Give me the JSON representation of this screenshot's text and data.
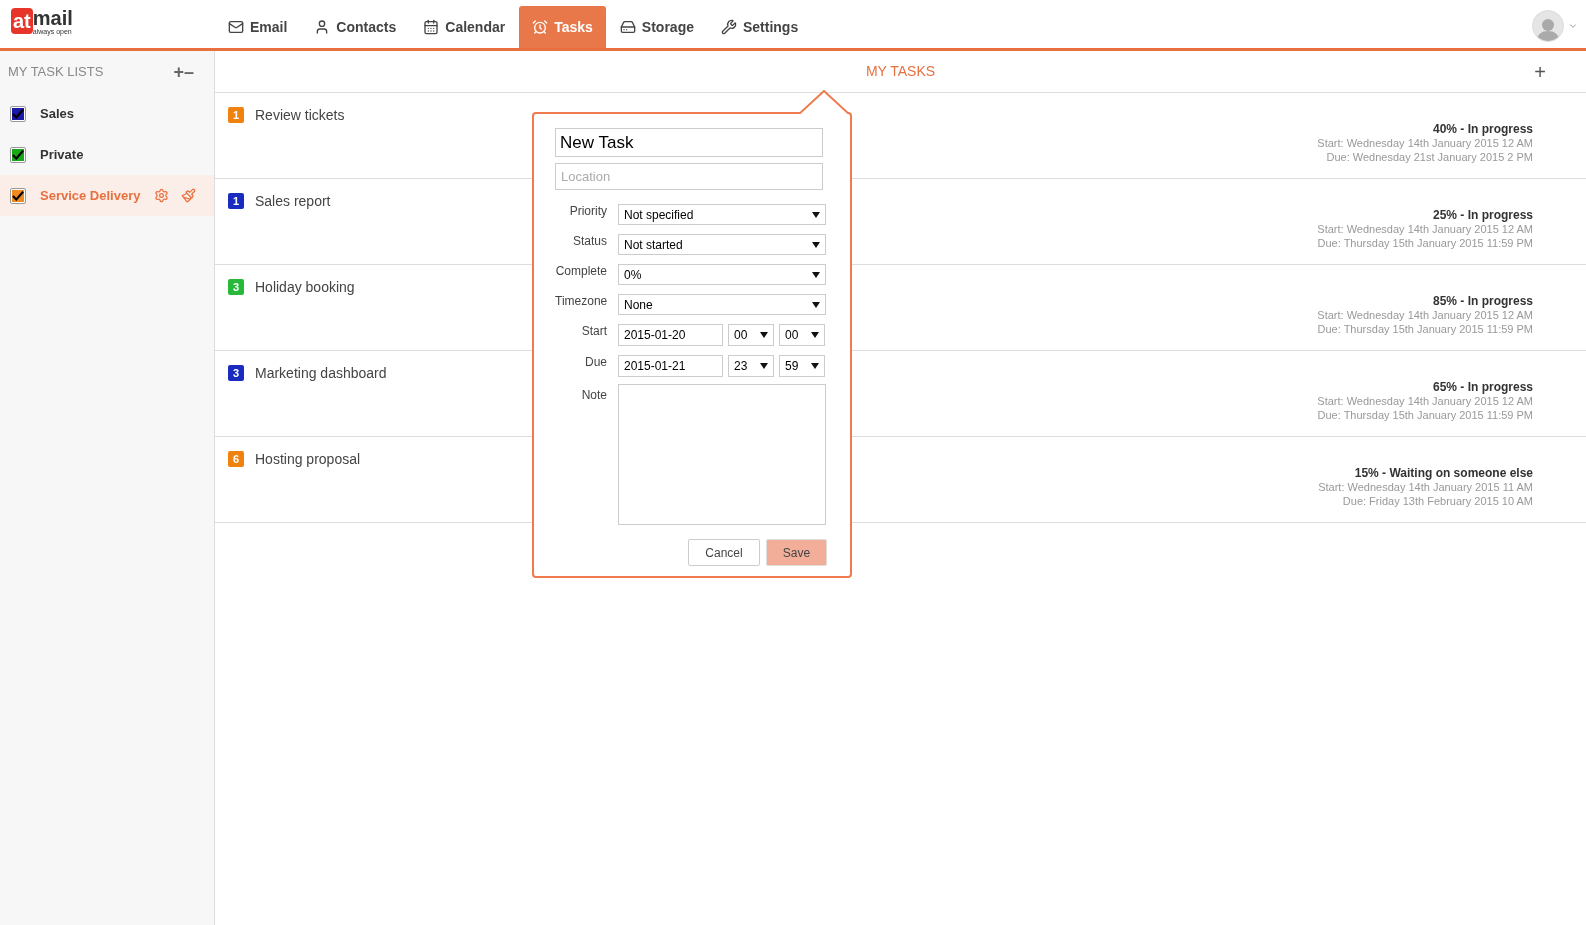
{
  "logo": {
    "mark": "at",
    "word": "mail",
    "tagline": "always open"
  },
  "nav": [
    {
      "label": "Email",
      "kind": "mail",
      "selected": false
    },
    {
      "label": "Contacts",
      "kind": "user",
      "selected": false
    },
    {
      "label": "Calendar",
      "kind": "calendar",
      "selected": false
    },
    {
      "label": "Tasks",
      "kind": "alarm",
      "selected": true
    },
    {
      "label": "Storage",
      "kind": "storage",
      "selected": false
    },
    {
      "label": "Settings",
      "kind": "tools",
      "selected": false
    }
  ],
  "sidebar": {
    "title": "MY TASK LISTS",
    "add": "+",
    "remove": "–",
    "items": [
      {
        "label": "Sales",
        "color": "#1a1aa8",
        "checked": true,
        "selected": false
      },
      {
        "label": "Private",
        "color": "#1aa81a",
        "checked": true,
        "selected": false
      },
      {
        "label": "Service Delivery",
        "color": "#f08a1c",
        "checked": true,
        "selected": true
      }
    ]
  },
  "main": {
    "title": "MY TASKS",
    "add": "+"
  },
  "tasks": [
    {
      "priority": "1",
      "color": "#f0820f",
      "title": "Review tickets",
      "status": "40% - In progress",
      "start": "Start: Wednesday 14th January 2015 12 AM",
      "due": "Due: Wednesday 21st January 2015 2 PM"
    },
    {
      "priority": "1",
      "color": "#1a2cc0",
      "title": "Sales report",
      "status": "25% - In progress",
      "start": "Start: Wednesday 14th January 2015 12 AM",
      "due": "Due: Thursday 15th January 2015 11:59 PM"
    },
    {
      "priority": "3",
      "color": "#28b83a",
      "title": "Holiday booking",
      "status": "85% - In progress",
      "start": "Start: Wednesday 14th January 2015 12 AM",
      "due": "Due: Thursday 15th January 2015 11:59 PM"
    },
    {
      "priority": "3",
      "color": "#1a2cc0",
      "title": "Marketing dashboard",
      "status": "65% - In progress",
      "start": "Start: Wednesday 14th January 2015 12 AM",
      "due": "Due: Thursday 15th January 2015 11:59 PM"
    },
    {
      "priority": "6",
      "color": "#f0820f",
      "title": "Hosting proposal",
      "status": "15% - Waiting on someone else",
      "start": "Start: Wednesday 14th January 2015 11 AM",
      "due": "Due: Friday 13th February 2015 10 AM"
    }
  ],
  "popup": {
    "title_value": "New Task",
    "location_placeholder": "Location",
    "selects": [
      {
        "label": "Priority",
        "value": "Not specified"
      },
      {
        "label": "Status",
        "value": "Not started"
      },
      {
        "label": "Complete",
        "value": "0%"
      },
      {
        "label": "Timezone",
        "value": "None"
      }
    ],
    "dates": [
      {
        "label": "Start",
        "date": "2015-01-20",
        "hour": "00",
        "minute": "00"
      },
      {
        "label": "Due",
        "date": "2015-01-21",
        "hour": "23",
        "minute": "59"
      }
    ],
    "note_label": "Note",
    "cancel": "Cancel",
    "save": "Save"
  }
}
